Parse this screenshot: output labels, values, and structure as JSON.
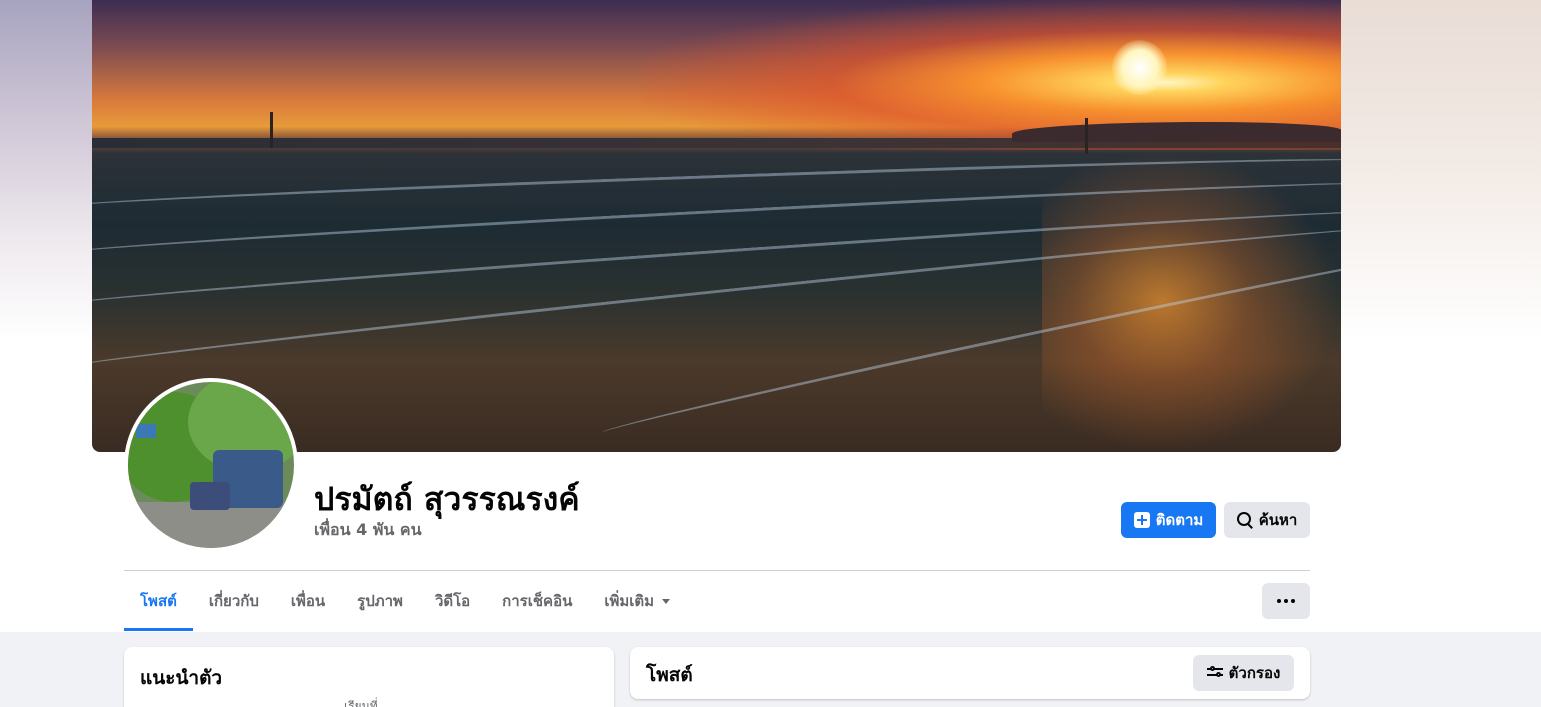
{
  "profile": {
    "name": "ปรมัตถ์ สุวรรณรงค์",
    "friends_count": "เพื่อน 4 พัน คน"
  },
  "actions": {
    "follow_label": "ติดตาม",
    "search_label": "ค้นหา"
  },
  "tabs": [
    {
      "label": "โพสต์",
      "active": true
    },
    {
      "label": "เกี่ยวกับ",
      "active": false
    },
    {
      "label": "เพื่อน",
      "active": false
    },
    {
      "label": "รูปภาพ",
      "active": false
    },
    {
      "label": "วิดีโอ",
      "active": false
    },
    {
      "label": "การเช็คอิน",
      "active": false
    },
    {
      "label": "เพิ่มเติม",
      "active": false
    }
  ],
  "intro": {
    "title": "แนะนำตัว",
    "peek_text": "เรียนที่"
  },
  "posts": {
    "title": "โพสต์",
    "filter_label": "ตัวกรอง"
  },
  "colors": {
    "accent": "#1877f2",
    "secondary_button": "#e4e6eb",
    "feed_background": "#f0f2f5"
  },
  "icons": {
    "follow": "follow-plus-icon",
    "search": "search-icon",
    "more": "more-dots-icon",
    "filter": "filter-sliders-icon",
    "dropdown": "caret-down-icon"
  }
}
